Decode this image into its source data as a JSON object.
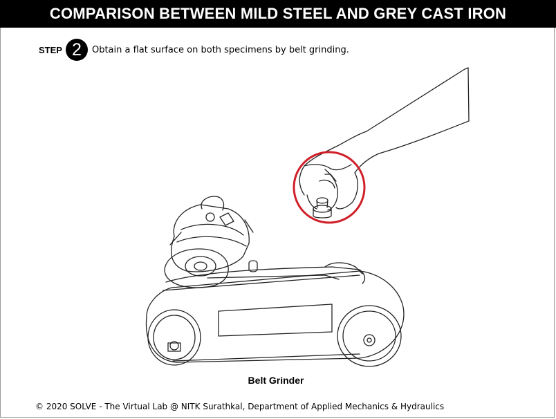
{
  "header": {
    "title": "COMPARISON BETWEEN MILD STEEL AND GREY CAST IRON"
  },
  "step": {
    "label": "STEP",
    "number": "2",
    "instruction": "Obtain a flat surface on both specimens by belt grinding."
  },
  "illustration": {
    "caption": "Belt Grinder",
    "highlight_color": "#d0202a"
  },
  "footer": {
    "text": "© 2020 SOLVE - The Virtual Lab @ NITK Surathkal, Department of Applied Mechanics & Hydraulics"
  }
}
